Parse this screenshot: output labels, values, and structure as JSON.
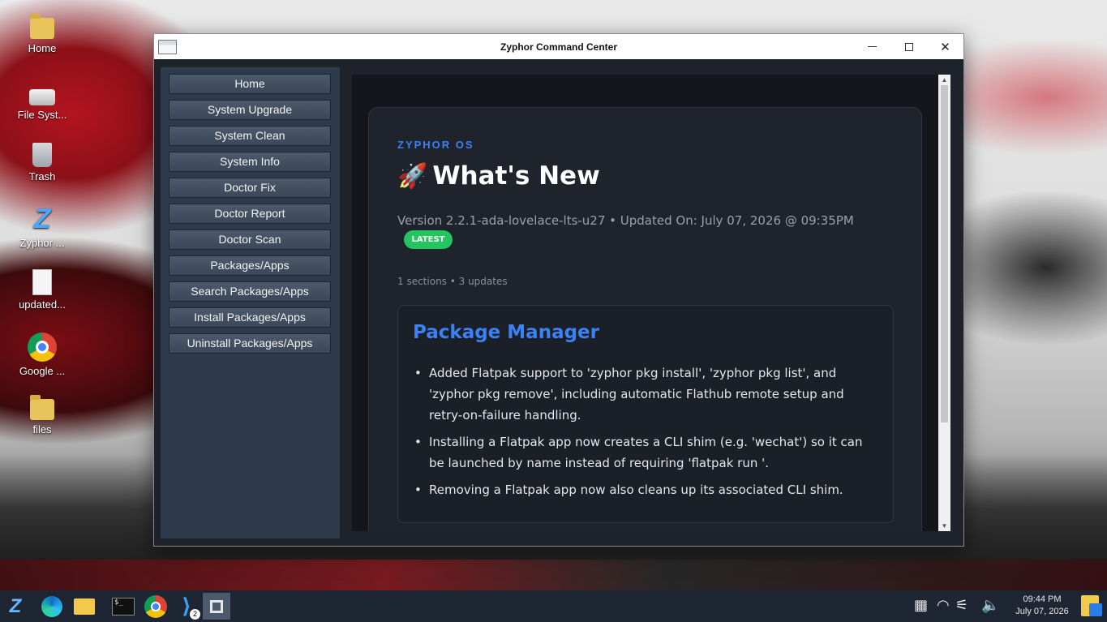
{
  "desktop": {
    "icons": [
      {
        "label": "Home",
        "icon": "home-folder-icon"
      },
      {
        "label": "File Syst...",
        "icon": "drive-icon"
      },
      {
        "label": "Trash",
        "icon": "trash-icon"
      },
      {
        "label": "Zyphor ...",
        "icon": "zyphor-logo-icon"
      },
      {
        "label": "updated...",
        "icon": "document-icon"
      },
      {
        "label": "Google ...",
        "icon": "chrome-icon"
      },
      {
        "label": "files",
        "icon": "folder-icon"
      }
    ]
  },
  "window": {
    "title": "Zyphor Command Center",
    "controls": {
      "minimize": "minimize",
      "maximize": "maximize",
      "close": "✕"
    }
  },
  "sidebar": {
    "items": [
      {
        "label": "Home"
      },
      {
        "label": "System Upgrade"
      },
      {
        "label": "System Clean"
      },
      {
        "label": "System Info"
      },
      {
        "label": "Doctor Fix"
      },
      {
        "label": "Doctor Report"
      },
      {
        "label": "Doctor Scan"
      },
      {
        "label": "Packages/Apps"
      },
      {
        "label": "Search Packages/Apps"
      },
      {
        "label": "Install Packages/Apps"
      },
      {
        "label": "Uninstall Packages/Apps"
      }
    ]
  },
  "content": {
    "eyebrow": "ZYPHOR OS",
    "rocket": "🚀",
    "heading": "What's New",
    "version_line": "Version 2.2.1-ada-lovelace-lts-u27 • Updated On: July 07, 2026 @ 09:35PM",
    "badge": "LATEST",
    "counts": "1 sections • 3 updates",
    "section": {
      "title": "Package Manager",
      "updates": [
        "Added Flatpak support to 'zyphor pkg install', 'zyphor pkg list', and 'zyphor pkg remove', including automatic Flathub remote setup and retry-on-failure handling.",
        "Installing a Flatpak app now creates a CLI shim (e.g. 'wechat') so it can be launched by name instead of requiring 'flatpak run '.",
        "Removing a Flatpak app now also cleans up its associated CLI shim."
      ]
    }
  },
  "taskbar": {
    "terminal_prompt": "$_",
    "vscode_badge": "2",
    "clock_time": "09:44 PM",
    "clock_date": "July 07, 2026"
  },
  "colors": {
    "accent": "#3b82f6",
    "badge": "#22c55e",
    "sidebar_bg": "#2d3b4d",
    "content_bg": "#14161b"
  }
}
